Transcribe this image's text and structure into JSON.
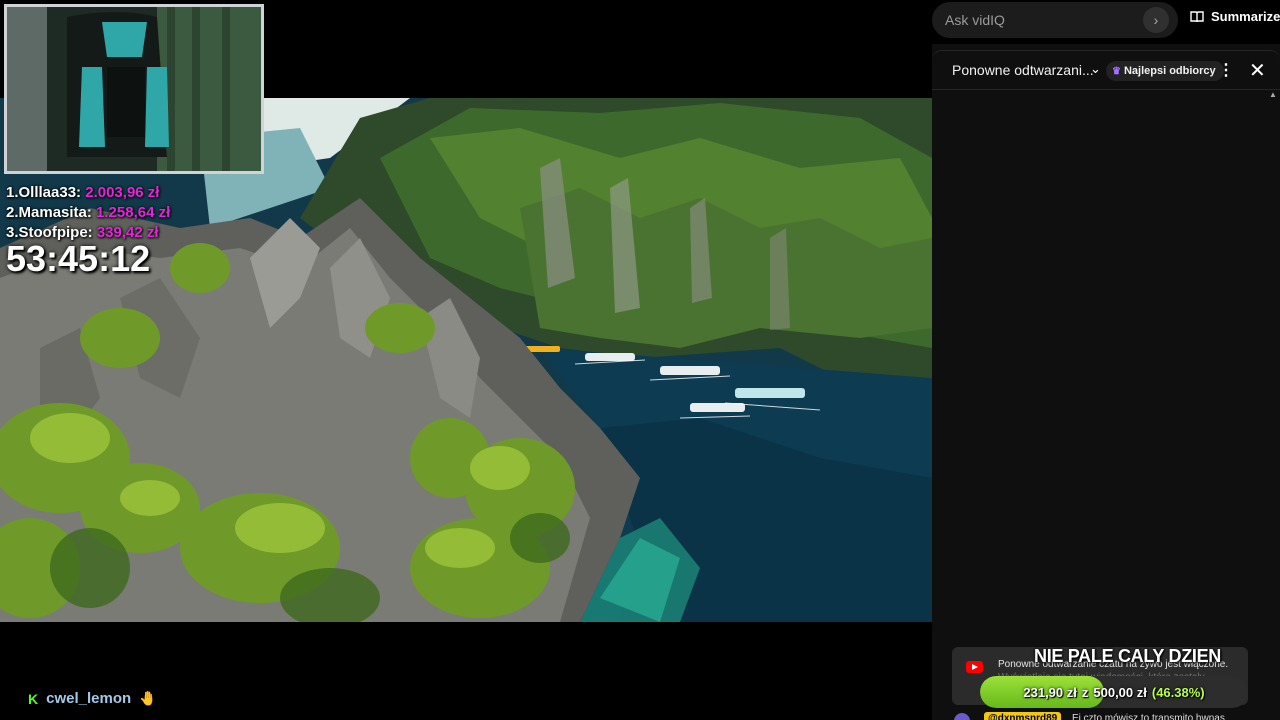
{
  "overlay": {
    "leaderboard": [
      {
        "rank": "1.",
        "name": "Olllaa33:",
        "amount": "2.003,96 zł"
      },
      {
        "rank": "2.",
        "name": "Mamasita:",
        "amount": "1.258,64 zł"
      },
      {
        "rank": "3.",
        "name": "Stoofpipe:",
        "amount": "339,42 zł"
      }
    ],
    "timer": "53:45:12",
    "nickname": "cwel_lemon",
    "kick_icon": "K",
    "goal": {
      "title": "NIE PALE CALY DZIEN",
      "current": "231,90 zł",
      "separator": "z",
      "target": "500,00 zł",
      "percent_label": "(46.38%)",
      "progress": 0.4638
    }
  },
  "vidiq": {
    "ask_placeholder": "Ask vidIQ",
    "summarize_label": "Summarize"
  },
  "chat": {
    "title": "Ponowne odtwarzani...",
    "top_fans_label": "Najlepsi odbiorcy",
    "notice_line1": "Ponowne odtwarzanie czatu na żywo jest włączone.",
    "notice_line2": "Wyświetlają się tutaj wiadomości, które zostały",
    "peek_badge": "@dxnmsnrd89",
    "peek_text": "Ej czto mówisz to transmito hwnas"
  },
  "colors": {
    "donation_amount": "#e028d6",
    "goal_fill": "#7ccc26",
    "kick_green": "#53fc18"
  }
}
